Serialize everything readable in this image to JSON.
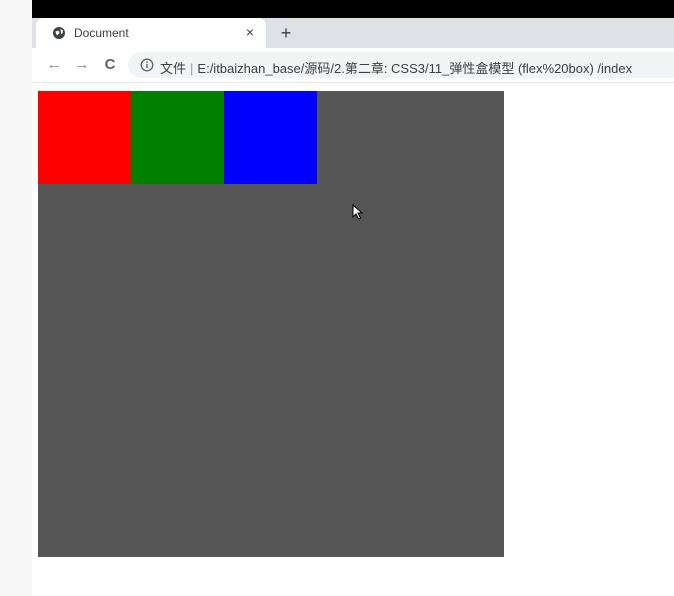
{
  "browser": {
    "tab": {
      "title": "Document",
      "favicon": "globe-icon",
      "close_glyph": "×"
    },
    "new_tab_glyph": "+",
    "nav": {
      "back_glyph": "←",
      "forward_glyph": "→",
      "reload_glyph": "C"
    },
    "address": {
      "info_icon": "info-icon",
      "label": "文件",
      "url": "E:/itbaizhan_base/源码/2.第二章: CSS3/11_弹性盒模型 (flex%20box) /index"
    }
  },
  "page": {
    "container": {
      "color": "#555555"
    },
    "items": [
      {
        "color": "#ff0000"
      },
      {
        "color": "#008000"
      },
      {
        "color": "#0000ff"
      }
    ]
  }
}
